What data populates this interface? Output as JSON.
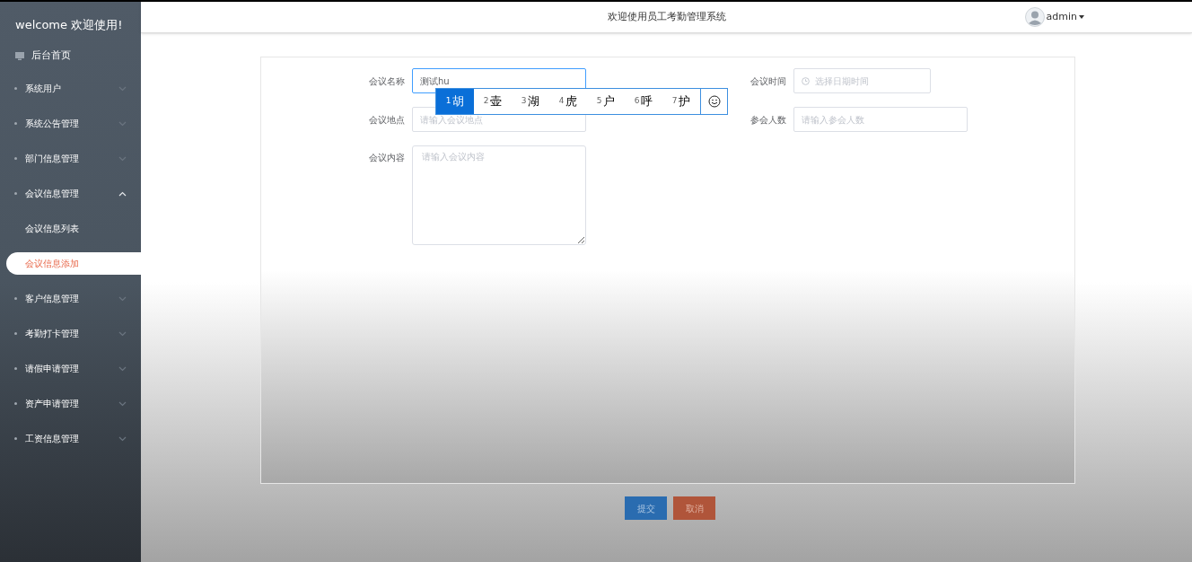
{
  "sidebar": {
    "welcome": "welcome 欢迎使用!",
    "items": [
      {
        "kind": "link",
        "label": "后台首页"
      },
      {
        "kind": "menu",
        "label": "系统用户",
        "expanded": false
      },
      {
        "kind": "menu",
        "label": "系统公告管理",
        "expanded": false
      },
      {
        "kind": "menu",
        "label": "部门信息管理",
        "expanded": false
      },
      {
        "kind": "menu",
        "label": "会议信息管理",
        "expanded": true,
        "children": [
          {
            "label": "会议信息列表",
            "selected": false
          },
          {
            "label": "会议信息添加",
            "selected": true
          }
        ]
      },
      {
        "kind": "menu",
        "label": "客户信息管理",
        "expanded": false
      },
      {
        "kind": "menu",
        "label": "考勤打卡管理",
        "expanded": false
      },
      {
        "kind": "menu",
        "label": "请假申请管理",
        "expanded": false
      },
      {
        "kind": "menu",
        "label": "资产申请管理",
        "expanded": false
      },
      {
        "kind": "menu",
        "label": "工资信息管理",
        "expanded": false
      }
    ]
  },
  "header": {
    "title": "欢迎使用员工考勤管理系统",
    "user": "admin"
  },
  "form": {
    "name": {
      "label": "会议名称",
      "value": "测试hu"
    },
    "time": {
      "label": "会议时间",
      "placeholder": "选择日期时间"
    },
    "place": {
      "label": "会议地点",
      "placeholder": "请输入会议地点"
    },
    "count": {
      "label": "参会人数",
      "placeholder": "请输入参会人数"
    },
    "content": {
      "label": "会议内容",
      "placeholder": "请输入会议内容"
    }
  },
  "ime": {
    "candidates": [
      {
        "index": "1",
        "text": "胡",
        "selected": true
      },
      {
        "index": "2",
        "text": "壶",
        "selected": false
      },
      {
        "index": "3",
        "text": "湖",
        "selected": false
      },
      {
        "index": "4",
        "text": "虎",
        "selected": false
      },
      {
        "index": "5",
        "text": "户",
        "selected": false
      },
      {
        "index": "6",
        "text": "呼",
        "selected": false
      },
      {
        "index": "7",
        "text": "护",
        "selected": false
      }
    ]
  },
  "buttons": {
    "submit": "提交",
    "cancel": "取消"
  }
}
